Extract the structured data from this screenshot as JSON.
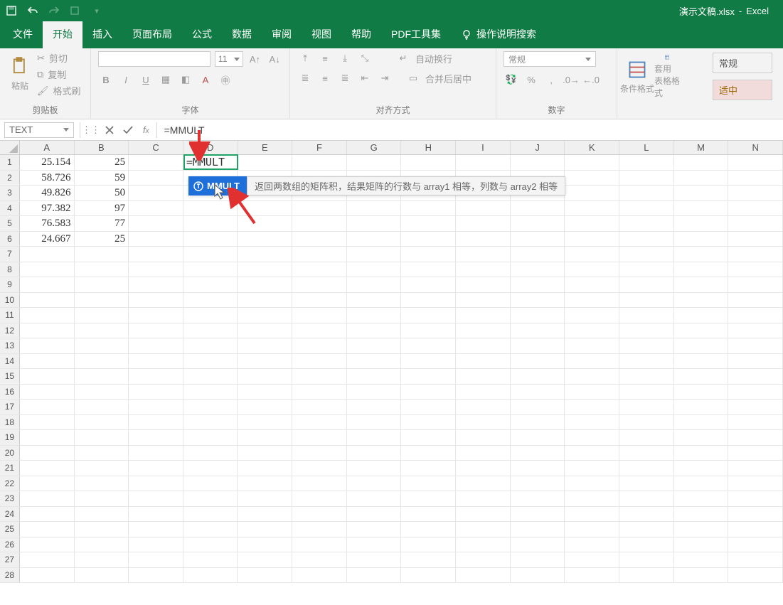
{
  "app": {
    "doc_title": "演示文稿.xlsx",
    "sep": "-",
    "app_name": "Excel"
  },
  "tabs": {
    "file": "文件",
    "home": "开始",
    "insert": "插入",
    "layout": "页面布局",
    "formulas": "公式",
    "data": "数据",
    "review": "审阅",
    "view": "视图",
    "help": "帮助",
    "pdf": "PDF工具集",
    "tell_me": "操作说明搜索"
  },
  "ribbon": {
    "paste": "粘贴",
    "cut": "剪切",
    "copy": "复制",
    "format_painter": "格式刷",
    "clipboard_group": "剪贴板",
    "font_size": "11",
    "font_group": "字体",
    "wrap": "自动换行",
    "merge": "合并后居中",
    "align_group": "对齐方式",
    "number_format": "常规",
    "number_group": "数字",
    "cond_format": "条件格式",
    "table_format_l1": "套用",
    "table_format_l2": "表格格式",
    "styles_general": "常规",
    "styles_neutral": "适中"
  },
  "formula_bar": {
    "name": "TEXT",
    "value": "=MMULT"
  },
  "columns": [
    "A",
    "B",
    "C",
    "D",
    "E",
    "F",
    "G",
    "H",
    "I",
    "J",
    "K",
    "L",
    "M",
    "N"
  ],
  "rows": [
    1,
    2,
    3,
    4,
    5,
    6,
    7,
    8,
    9,
    10,
    11,
    12,
    13,
    14,
    15,
    16,
    17,
    18,
    19,
    20,
    21,
    22,
    23,
    24,
    25,
    26,
    27,
    28
  ],
  "cells": {
    "r1": {
      "A": "25.154",
      "B": "25",
      "D": "=MMULT"
    },
    "r2": {
      "A": "58.726",
      "B": "59"
    },
    "r3": {
      "A": "49.826",
      "B": "50"
    },
    "r4": {
      "A": "97.382",
      "B": "97"
    },
    "r5": {
      "A": "76.583",
      "B": "77"
    },
    "r6": {
      "A": "24.667",
      "B": "25"
    }
  },
  "tooltip": {
    "fn": "MMULT",
    "desc": "返回两数组的矩阵积，结果矩阵的行数与 array1 相等，列数与 array2 相等"
  }
}
